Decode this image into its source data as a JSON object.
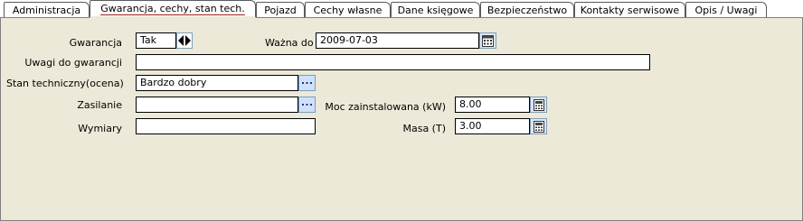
{
  "tabs": [
    {
      "label": "Administracja",
      "active": false
    },
    {
      "label": "Gwarancja, cechy, stan tech.",
      "active": true
    },
    {
      "label": "Pojazd",
      "active": false
    },
    {
      "label": "Cechy własne",
      "active": false
    },
    {
      "label": "Dane księgowe",
      "active": false
    },
    {
      "label": "Bezpieczeństwo",
      "active": false
    },
    {
      "label": "Kontakty serwisowe",
      "active": false
    },
    {
      "label": "Opis / Uwagi",
      "active": false
    }
  ],
  "form": {
    "gwarancja": {
      "label": "Gwarancja",
      "value": "Tak"
    },
    "wazna_do": {
      "label": "Ważna do",
      "value": "2009-07-03"
    },
    "uwagi": {
      "label": "Uwagi do gwarancji",
      "value": ""
    },
    "stan": {
      "label": "Stan techniczny(ocena)",
      "value": "Bardzo dobry"
    },
    "zasilanie": {
      "label": "Zasilanie",
      "value": ""
    },
    "moc": {
      "label": "Moc zainstalowana (kW)",
      "value": "8.00"
    },
    "wymiary": {
      "label": "Wymiary",
      "value": ""
    },
    "masa": {
      "label": "Masa (T)",
      "value": "3.00"
    }
  },
  "icons": {
    "spinner": "spin-arrows-icon",
    "calendar": "calendar-icon",
    "calculator": "calculator-icon",
    "ellipsis": "ellipsis-icon"
  },
  "colors": {
    "panel_bg": "#ece9d8",
    "button_bg": "#cfe0fa",
    "active_tab_underline": "#9b2020"
  }
}
